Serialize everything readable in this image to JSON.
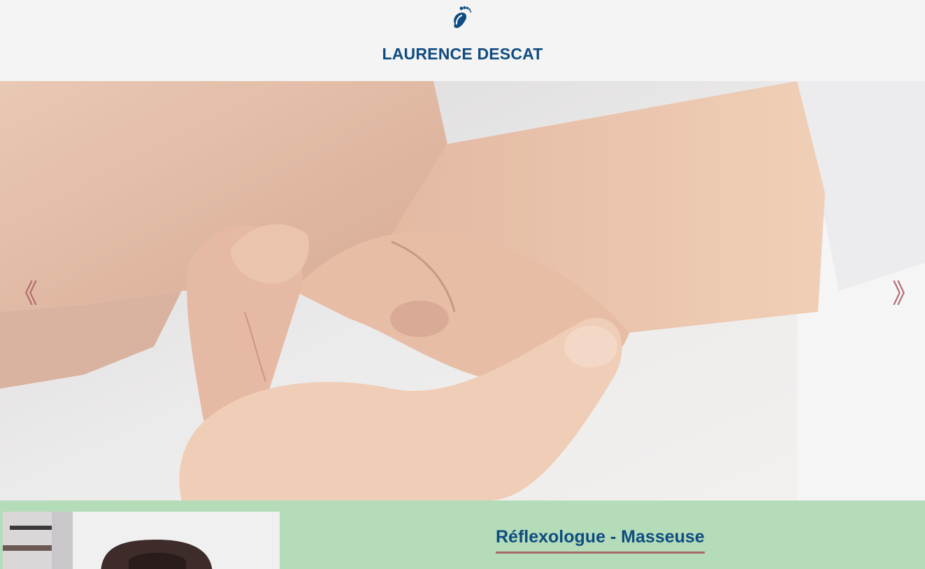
{
  "header": {
    "logo_icon": "footprint-icon",
    "title": "LAURENCE DESCAT"
  },
  "slider": {
    "image": "hand-massage-photo",
    "prev_label": "《",
    "next_label": "》"
  },
  "intro": {
    "portrait": "portrait-photo",
    "title": "Réflexologue - Masseuse"
  },
  "colors": {
    "brand_blue": "#0f4c81",
    "accent_rose": "#a8686b",
    "band_green": "#b4dcb9",
    "header_bg": "#f4f4f4"
  }
}
